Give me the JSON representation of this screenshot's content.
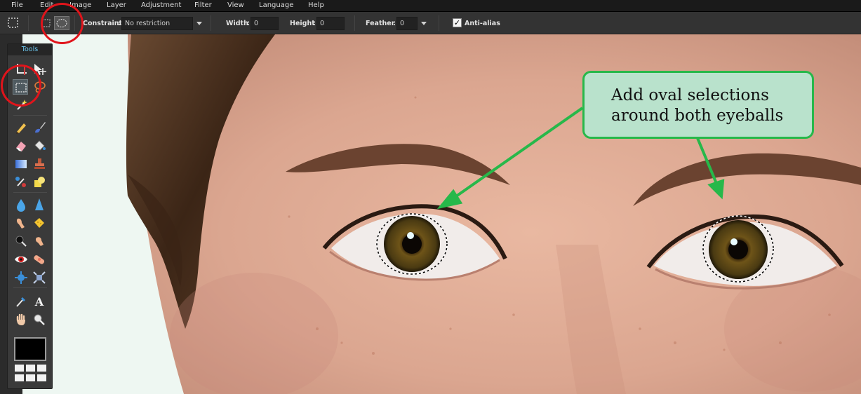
{
  "menu": [
    "File",
    "Edit",
    "Image",
    "Layer",
    "Adjustment",
    "Filter",
    "View",
    "Language",
    "Help"
  ],
  "options": {
    "constraint_label": "Constraint",
    "constraint_value": "No restriction",
    "width_label": "Width",
    "width_value": "0",
    "height_label": "Height",
    "height_value": "0",
    "feather_label": "Feather",
    "feather_value": "0",
    "antialias_label": "Anti-alias",
    "antialias_checked": true
  },
  "tools_panel": {
    "title": "Tools",
    "icons": [
      "crop-icon",
      "move-icon",
      "rect-marquee-icon",
      "lasso-icon",
      "magic-wand-icon",
      "pencil-icon",
      "brush-icon",
      "eraser-icon",
      "paint-bucket-icon",
      "gradient-icon",
      "clone-stamp-icon",
      "color-replace-icon",
      "shape-icon",
      "blur-icon",
      "sharpen-icon",
      "smudge-icon",
      "sponge-icon",
      "dodge-icon",
      "burn-icon",
      "red-eye-icon",
      "spot-heal-icon",
      "bloat-icon",
      "pinch-icon",
      "color-picker-icon",
      "type-icon",
      "hand-icon",
      "zoom-icon"
    ],
    "foreground_color": "#000000"
  },
  "annotation": {
    "callout_text": "Add oval selections\naround both eyeballs",
    "callout_bg": "#b9e2cc",
    "accent_green": "#27b84a",
    "highlight_red": "#e0141b"
  }
}
